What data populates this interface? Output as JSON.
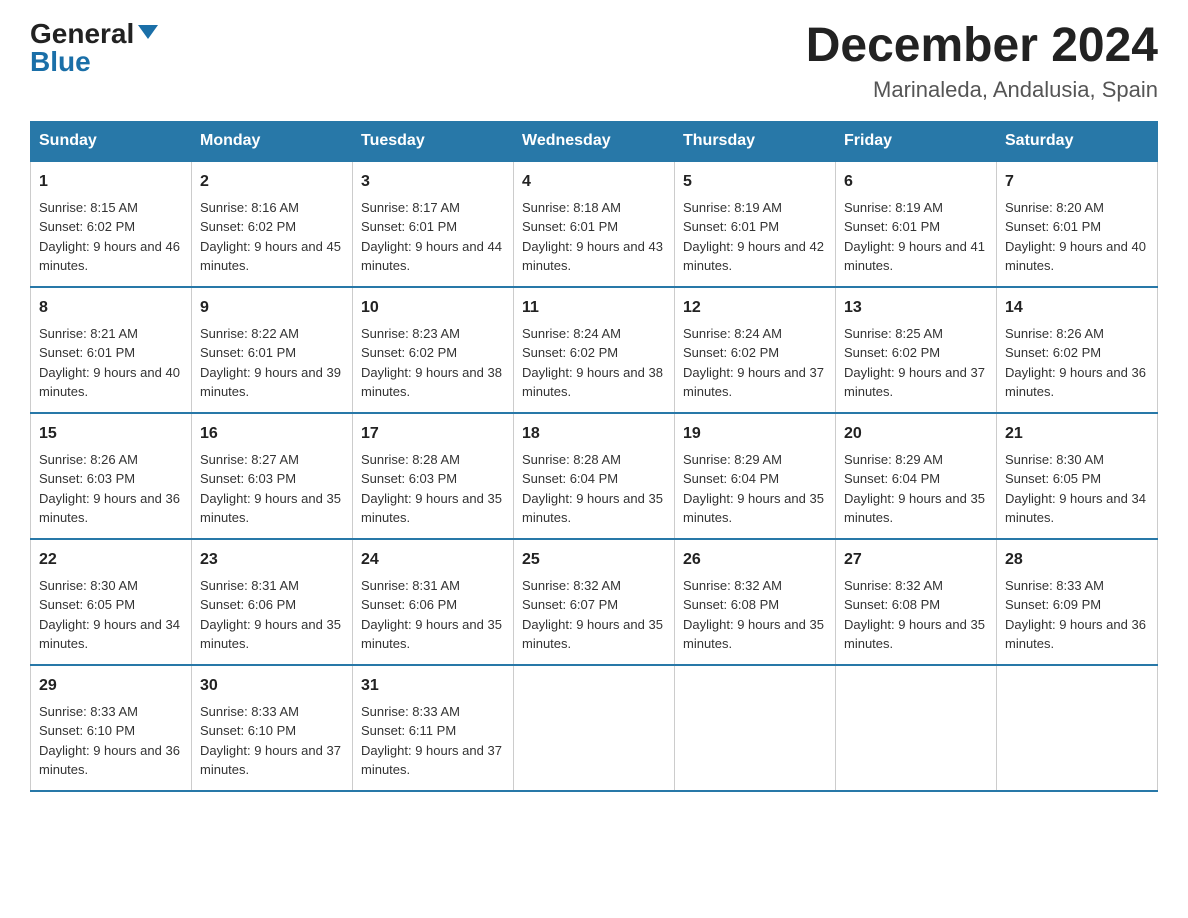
{
  "header": {
    "logo_general": "General",
    "logo_blue": "Blue",
    "month_title": "December 2024",
    "location": "Marinaleda, Andalusia, Spain"
  },
  "weekdays": [
    "Sunday",
    "Monday",
    "Tuesday",
    "Wednesday",
    "Thursday",
    "Friday",
    "Saturday"
  ],
  "weeks": [
    [
      {
        "day": "1",
        "sunrise": "8:15 AM",
        "sunset": "6:02 PM",
        "daylight": "9 hours and 46 minutes."
      },
      {
        "day": "2",
        "sunrise": "8:16 AM",
        "sunset": "6:02 PM",
        "daylight": "9 hours and 45 minutes."
      },
      {
        "day": "3",
        "sunrise": "8:17 AM",
        "sunset": "6:01 PM",
        "daylight": "9 hours and 44 minutes."
      },
      {
        "day": "4",
        "sunrise": "8:18 AM",
        "sunset": "6:01 PM",
        "daylight": "9 hours and 43 minutes."
      },
      {
        "day": "5",
        "sunrise": "8:19 AM",
        "sunset": "6:01 PM",
        "daylight": "9 hours and 42 minutes."
      },
      {
        "day": "6",
        "sunrise": "8:19 AM",
        "sunset": "6:01 PM",
        "daylight": "9 hours and 41 minutes."
      },
      {
        "day": "7",
        "sunrise": "8:20 AM",
        "sunset": "6:01 PM",
        "daylight": "9 hours and 40 minutes."
      }
    ],
    [
      {
        "day": "8",
        "sunrise": "8:21 AM",
        "sunset": "6:01 PM",
        "daylight": "9 hours and 40 minutes."
      },
      {
        "day": "9",
        "sunrise": "8:22 AM",
        "sunset": "6:01 PM",
        "daylight": "9 hours and 39 minutes."
      },
      {
        "day": "10",
        "sunrise": "8:23 AM",
        "sunset": "6:02 PM",
        "daylight": "9 hours and 38 minutes."
      },
      {
        "day": "11",
        "sunrise": "8:24 AM",
        "sunset": "6:02 PM",
        "daylight": "9 hours and 38 minutes."
      },
      {
        "day": "12",
        "sunrise": "8:24 AM",
        "sunset": "6:02 PM",
        "daylight": "9 hours and 37 minutes."
      },
      {
        "day": "13",
        "sunrise": "8:25 AM",
        "sunset": "6:02 PM",
        "daylight": "9 hours and 37 minutes."
      },
      {
        "day": "14",
        "sunrise": "8:26 AM",
        "sunset": "6:02 PM",
        "daylight": "9 hours and 36 minutes."
      }
    ],
    [
      {
        "day": "15",
        "sunrise": "8:26 AM",
        "sunset": "6:03 PM",
        "daylight": "9 hours and 36 minutes."
      },
      {
        "day": "16",
        "sunrise": "8:27 AM",
        "sunset": "6:03 PM",
        "daylight": "9 hours and 35 minutes."
      },
      {
        "day": "17",
        "sunrise": "8:28 AM",
        "sunset": "6:03 PM",
        "daylight": "9 hours and 35 minutes."
      },
      {
        "day": "18",
        "sunrise": "8:28 AM",
        "sunset": "6:04 PM",
        "daylight": "9 hours and 35 minutes."
      },
      {
        "day": "19",
        "sunrise": "8:29 AM",
        "sunset": "6:04 PM",
        "daylight": "9 hours and 35 minutes."
      },
      {
        "day": "20",
        "sunrise": "8:29 AM",
        "sunset": "6:04 PM",
        "daylight": "9 hours and 35 minutes."
      },
      {
        "day": "21",
        "sunrise": "8:30 AM",
        "sunset": "6:05 PM",
        "daylight": "9 hours and 34 minutes."
      }
    ],
    [
      {
        "day": "22",
        "sunrise": "8:30 AM",
        "sunset": "6:05 PM",
        "daylight": "9 hours and 34 minutes."
      },
      {
        "day": "23",
        "sunrise": "8:31 AM",
        "sunset": "6:06 PM",
        "daylight": "9 hours and 35 minutes."
      },
      {
        "day": "24",
        "sunrise": "8:31 AM",
        "sunset": "6:06 PM",
        "daylight": "9 hours and 35 minutes."
      },
      {
        "day": "25",
        "sunrise": "8:32 AM",
        "sunset": "6:07 PM",
        "daylight": "9 hours and 35 minutes."
      },
      {
        "day": "26",
        "sunrise": "8:32 AM",
        "sunset": "6:08 PM",
        "daylight": "9 hours and 35 minutes."
      },
      {
        "day": "27",
        "sunrise": "8:32 AM",
        "sunset": "6:08 PM",
        "daylight": "9 hours and 35 minutes."
      },
      {
        "day": "28",
        "sunrise": "8:33 AM",
        "sunset": "6:09 PM",
        "daylight": "9 hours and 36 minutes."
      }
    ],
    [
      {
        "day": "29",
        "sunrise": "8:33 AM",
        "sunset": "6:10 PM",
        "daylight": "9 hours and 36 minutes."
      },
      {
        "day": "30",
        "sunrise": "8:33 AM",
        "sunset": "6:10 PM",
        "daylight": "9 hours and 37 minutes."
      },
      {
        "day": "31",
        "sunrise": "8:33 AM",
        "sunset": "6:11 PM",
        "daylight": "9 hours and 37 minutes."
      },
      null,
      null,
      null,
      null
    ]
  ],
  "labels": {
    "sunrise": "Sunrise:",
    "sunset": "Sunset:",
    "daylight": "Daylight:"
  }
}
